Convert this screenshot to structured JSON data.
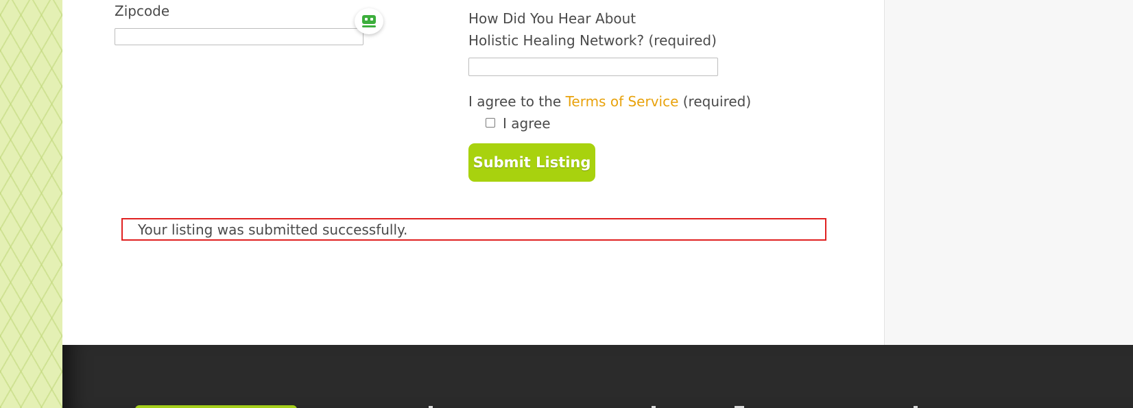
{
  "form": {
    "zipcode_label": "Zipcode",
    "zipcode_value": "",
    "hear_about_line1": "How Did You Hear About",
    "hear_about_line2": "Holistic Healing Network? (required)",
    "hear_about_value": "",
    "agree_prefix": "I agree to the",
    "terms_link": "Terms of Service",
    "agree_suffix": "(required)",
    "checkbox_label": "I agree",
    "checkbox_checked": false,
    "submit_label": "Submit Listing"
  },
  "message": {
    "success_text": "Your listing was submitted successfully."
  },
  "icons": {
    "helper": "robot-face-icon"
  },
  "colors": {
    "accent_green": "#a8d20e",
    "link_orange": "#e8a20c",
    "error_border": "#e02020",
    "footer_bg": "#2b2b2b"
  }
}
